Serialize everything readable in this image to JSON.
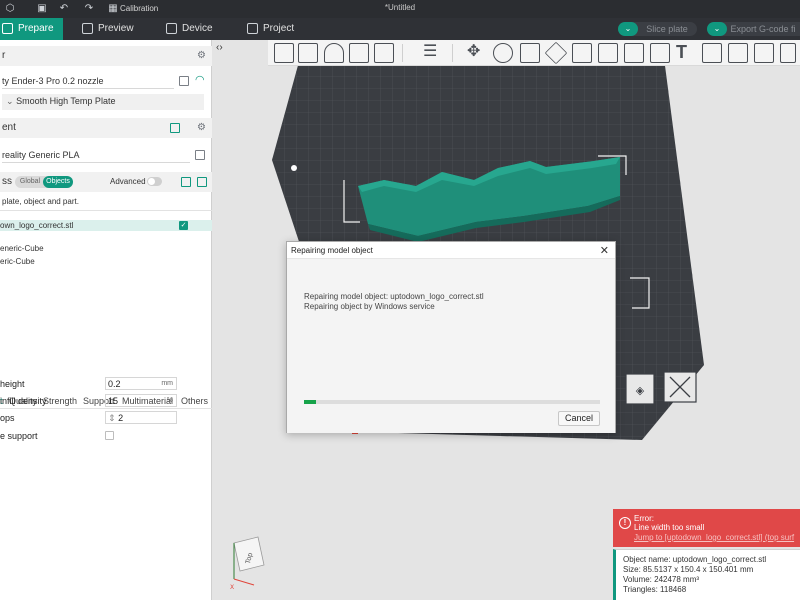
{
  "titlebar": {
    "title": "*Untitled",
    "calibration_label": "Calibration",
    "icons": [
      "app-logo-icon",
      "save-icon",
      "undo-icon",
      "redo-icon",
      "calibration-icon"
    ]
  },
  "tabs": [
    {
      "label": "Prepare",
      "active": true,
      "icon": "cube-icon"
    },
    {
      "label": "Preview",
      "active": false,
      "icon": "layers-icon"
    },
    {
      "label": "Device",
      "active": false,
      "icon": "monitor-icon"
    },
    {
      "label": "Project",
      "active": false,
      "icon": "project-icon"
    }
  ],
  "actions": {
    "slice_label": "Slice plate",
    "export_label": "Export G-code fi"
  },
  "printer": {
    "section_label": "r",
    "printer_name": "ty Ender-3 Pro 0.2 nozzle",
    "plate": "Smooth High Temp Plate"
  },
  "filament": {
    "section_label": "ent",
    "name": "reality Generic PLA"
  },
  "process": {
    "section_label": "ss",
    "toggle_global": "Global",
    "toggle_objects": "Objects",
    "advanced_label": "Advanced",
    "hint": "plate, object and part."
  },
  "objects": [
    {
      "name": "own_logo_correct.stl",
      "selected": true
    },
    {
      "name": "eneric-Cube",
      "selected": false
    },
    {
      "name": "eric-Cube",
      "selected": false
    }
  ],
  "param_tabs": [
    "t",
    "Quality",
    "Strength",
    "Support",
    "Multimaterial",
    "Others"
  ],
  "params": [
    {
      "label": "height",
      "value": "0.2",
      "unit": "mm"
    },
    {
      "label": "infill density",
      "value": "15",
      "unit": "%"
    },
    {
      "label": "ops",
      "value": "2",
      "unit": ""
    },
    {
      "label": "e support",
      "value": "",
      "unit": ""
    }
  ],
  "dialog": {
    "title": "Repairing model object",
    "line1": "Repairing model object: uptodown_logo_correct.stl",
    "line2": "Repairing object by Windows service",
    "progress": 0.04,
    "cancel_label": "Cancel"
  },
  "error": {
    "title": "Error:",
    "message": "Line width too small",
    "detail": "Jump to [uptodown_logo_correct.stl] (top surf"
  },
  "object_info": {
    "name": "Object name: uptodown_logo_correct.stl",
    "size": "Size: 85.5137 x 150.4 x 150.401 mm",
    "volume": "Volume: 242478 mm³",
    "triangles": "Triangles: 118468"
  },
  "cube_label": "Top",
  "colors": {
    "accent": "#10987f",
    "error": "#e04848",
    "model": "#1f8f7a",
    "plate": "#3a3d42",
    "progress": "#16a34a"
  }
}
